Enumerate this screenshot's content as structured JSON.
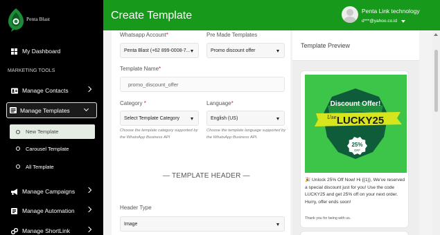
{
  "brand": {
    "name": "Penta Blast",
    "logo_color": "#1c8a36"
  },
  "colors": {
    "header_green": "#179a1b",
    "sidebar_bg": "#000000",
    "required_star": "#d9232d"
  },
  "sidebar": {
    "dashboard_label": "My Dashboard",
    "section_title": "MARKETING TOOLS",
    "items": [
      {
        "label": "Manage Contacts",
        "icon": "contacts-icon"
      },
      {
        "label": "Manage Templates",
        "icon": "templates-icon"
      },
      {
        "label": "Manage Campaigns",
        "icon": "megaphone-icon"
      },
      {
        "label": "Manage Automation",
        "icon": "automation-icon"
      },
      {
        "label": "Manage ShortLink",
        "icon": "link-icon"
      }
    ],
    "sub_items": [
      {
        "label": "New Template"
      },
      {
        "label": "Carousel Template"
      },
      {
        "label": "All Template"
      }
    ]
  },
  "header": {
    "title": "Create Template",
    "user_name": "Penta Link technology",
    "user_email": "d***@yahoo.co.id"
  },
  "form": {
    "whatsapp_account_label": "Whatsapp Account",
    "whatsapp_account_value": "Penta Blast (+62 899-0008-7...",
    "premade_label": "Pre Made Templates",
    "premade_value": "Promo discount offer",
    "template_name_label": "Template Name",
    "template_name_value": "promo_discount_offer",
    "category_label": "Category",
    "category_value": "Select Template Category",
    "category_hint": "Choose the template category supported by the WhatsApp Business API",
    "language_label": "Language",
    "language_value": "English (US)",
    "language_hint": "Choose the template language supported by the WhatsApp Business API.",
    "section_header": "— TEMPLATE HEADER —",
    "header_type_label": "Header Type",
    "header_type_value": "Image"
  },
  "preview": {
    "title": "Template Preview",
    "image": {
      "banner_text": "Discount Offer!",
      "script_text": "Use",
      "code_text": "LUCKY25",
      "badge_value": "25%",
      "badge_sub": "OFF"
    },
    "message": "🎉 Unlock 25% Off Now! Hi {{1}}, We've reserved a special discount just for you! Use the code LUCKY25 and get 25% off on your next order. Hurry, offer ends soon!",
    "footer": "Thank you for being with us."
  }
}
